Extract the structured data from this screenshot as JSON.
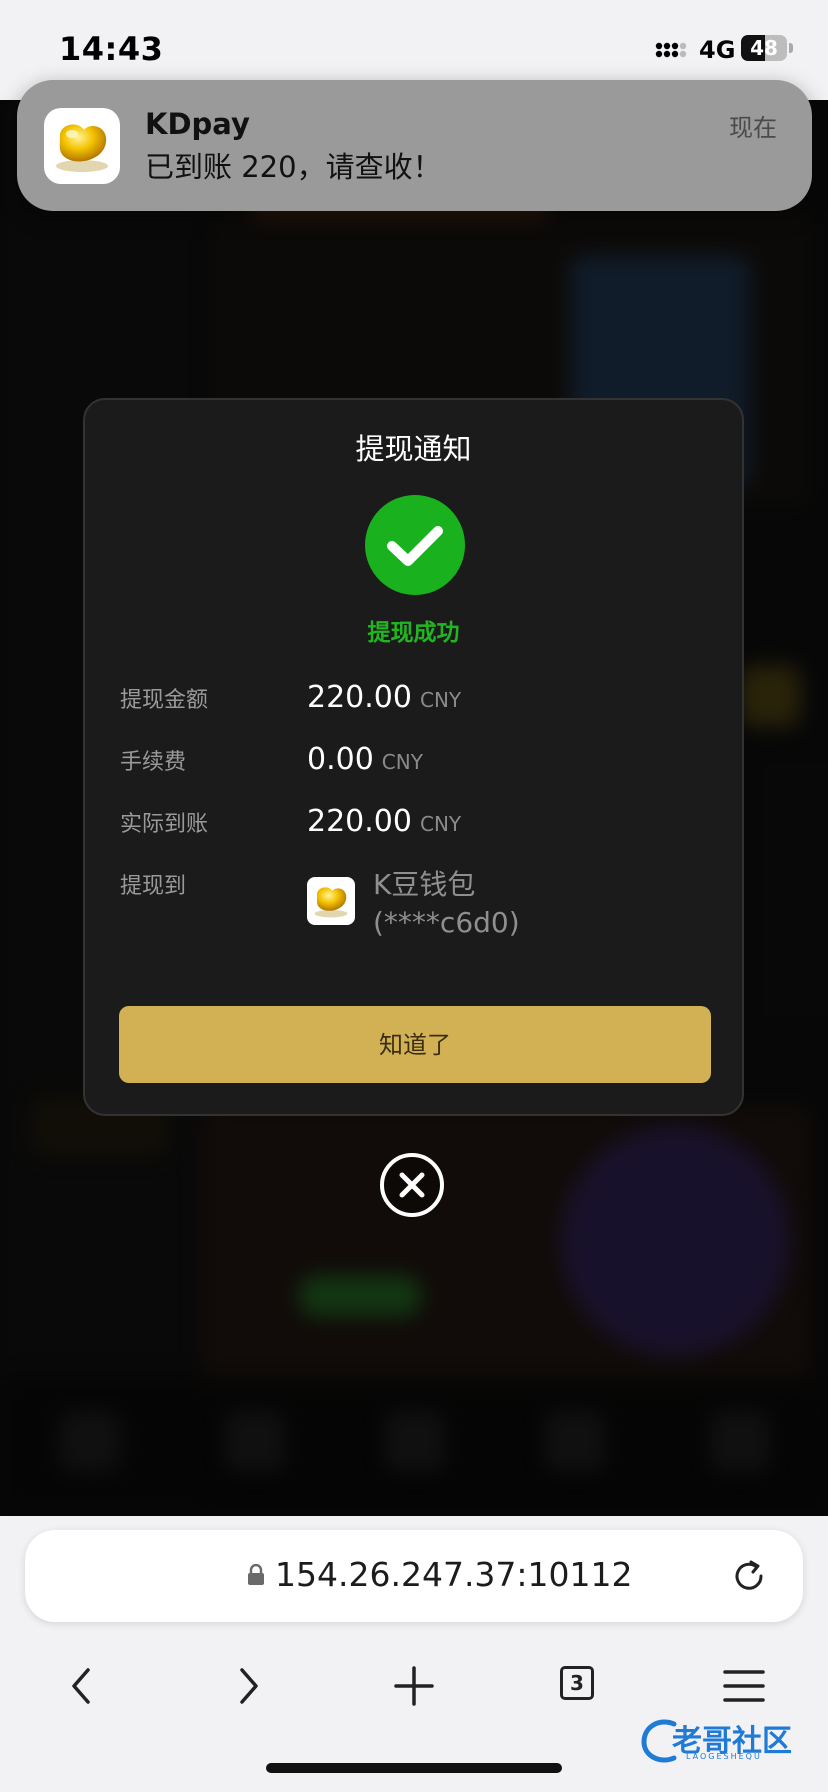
{
  "status_bar": {
    "time": "14:43",
    "network": "4G",
    "battery": "48"
  },
  "notification": {
    "app": "KDpay",
    "message": "已到账 220，请查收！",
    "time": "现在"
  },
  "modal": {
    "title": "提现通知",
    "status": "提现成功",
    "rows": [
      {
        "label": "提现金额",
        "value": "220.00",
        "unit": "CNY"
      },
      {
        "label": "手续费",
        "value": "0.00",
        "unit": "CNY"
      },
      {
        "label": "实际到账",
        "value": "220.00",
        "unit": "CNY"
      },
      {
        "label": "提现到",
        "wallet_name": "K豆钱包",
        "wallet_account": "(****c6d0)"
      }
    ],
    "ok_button": "知道了"
  },
  "browser": {
    "url": "154.26.247.37:10112",
    "tabs_count": "3"
  },
  "watermark": {
    "text": "老哥社区",
    "sub": "LAOGESHEQU"
  },
  "colors": {
    "success": "#1ab11e",
    "accent": "#d2b054",
    "modal_bg": "#1b1b1b"
  }
}
